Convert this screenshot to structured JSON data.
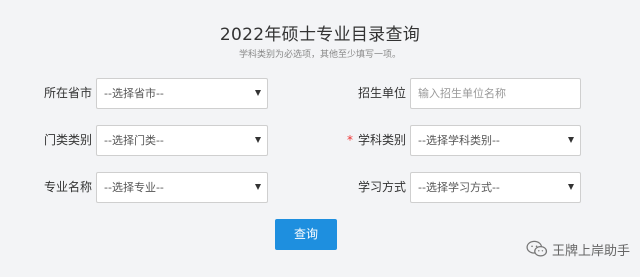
{
  "header": {
    "title": "2022年硕士专业目录查询",
    "subtitle": "学科类别为必选项，其他至少填写一项。"
  },
  "form": {
    "province": {
      "label": "所在省市",
      "value": "--选择省市--"
    },
    "school": {
      "label": "招生单位",
      "placeholder": "输入招生单位名称"
    },
    "category": {
      "label": "门类类别",
      "value": "--选择门类--"
    },
    "discipline": {
      "required_mark": "*",
      "label": "学科类别",
      "value": "--选择学科类别--"
    },
    "major": {
      "label": "专业名称",
      "value": "--选择专业--"
    },
    "study_mode": {
      "label": "学习方式",
      "value": "--选择学习方式--"
    },
    "submit_label": "查询"
  },
  "watermark": {
    "text": "王牌上岸助手",
    "icon": "wechat-icon"
  },
  "colors": {
    "accent": "#1e8fdf",
    "required": "#ee3333",
    "background": "#f3f4f6"
  }
}
